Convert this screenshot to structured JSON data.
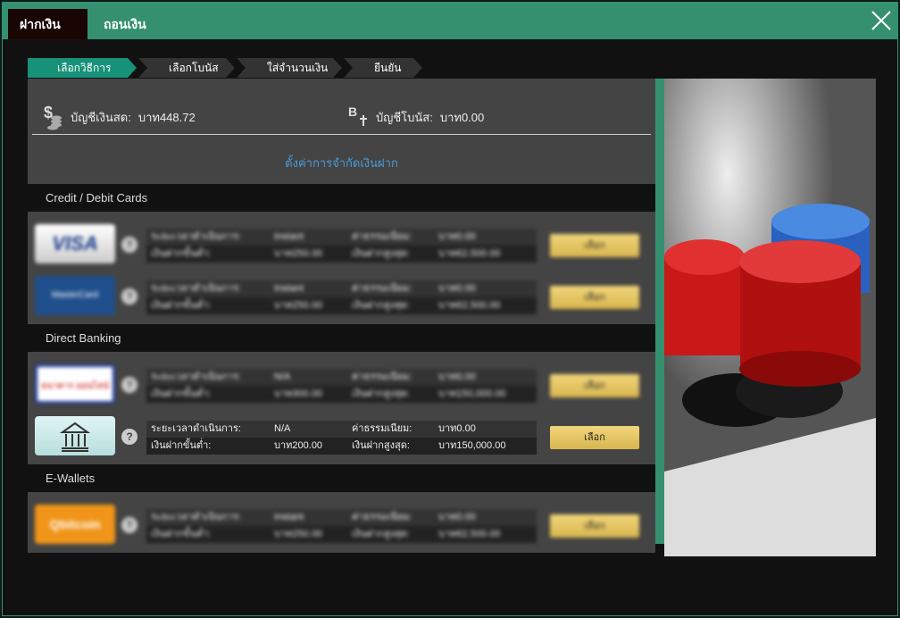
{
  "header": {
    "tabs": [
      {
        "label": "ฝากเงิน",
        "active": true
      },
      {
        "label": "ถอนเงิน",
        "active": false
      }
    ],
    "close_icon": "close-x-icon"
  },
  "steps": [
    {
      "label": "เลือกวิธีการ",
      "active": true
    },
    {
      "label": "เลือกโบนัส"
    },
    {
      "label": "ใส่จำนวนเงิน"
    },
    {
      "label": "ยืนยัน"
    }
  ],
  "balance": {
    "cash_label": "บัญชีเงินสด:",
    "cash_value": "บาท448.72",
    "bonus_label": "บัญชีโบนัส:",
    "bonus_value": "บาท0.00",
    "limit_link": "ตั้งค่าการจำกัดเงินฝาก"
  },
  "labels": {
    "time": "ระยะเวลาดำเนินการ:",
    "fee": "ค่าธรรมเนียม:",
    "min": "เงินฝากขั้นต่ำ:",
    "max": "เงินฝากสูงสุด:",
    "select": "เลือก",
    "help": "?"
  },
  "sections": [
    {
      "title": "Credit / Debit Cards",
      "methods": [
        {
          "logo": "VISA",
          "time": "Instant",
          "fee": "บาท0.00",
          "min": "บาท250.00",
          "max": "บาท62,500.00",
          "blurred": true
        },
        {
          "logo": "MasterCard",
          "time": "Instant",
          "fee": "บาท0.00",
          "min": "บาท250.00",
          "max": "บาท62,500.00",
          "blurred": true
        }
      ]
    },
    {
      "title": "Direct Banking",
      "methods": [
        {
          "logo": "ธนาคาร ออนไลน์",
          "time": "N/A",
          "fee": "บาท0.00",
          "min": "บาท300.00",
          "max": "บาท150,000.00",
          "blurred": true
        },
        {
          "logo": "bank-icon",
          "time": "N/A",
          "fee": "บาท0.00",
          "min": "บาท200.00",
          "max": "บาท150,000.00",
          "blurred": false
        }
      ]
    },
    {
      "title": "E-Wallets",
      "methods": [
        {
          "logo": "Qbitcoin",
          "time": "Instant",
          "fee": "บาท0.00",
          "min": "บาท250.00",
          "max": "บาท62,500.00",
          "blurred": true
        }
      ]
    }
  ],
  "colors": {
    "accent": "#35906f",
    "step_active": "#179278",
    "button": "#e6c665",
    "link": "#4a9ad8"
  }
}
